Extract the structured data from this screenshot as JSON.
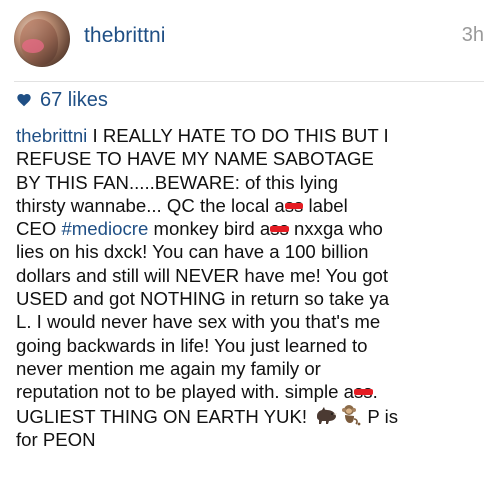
{
  "post": {
    "username": "thebrittni",
    "time_ago": "3h",
    "likes": "67 likes",
    "colors": {
      "link": "#1f4f85",
      "censor": "#e51c23",
      "time": "#9a9a9a"
    },
    "avatar_icon": "profile-photo",
    "heart_icon": "heart-icon",
    "emoji_icons": [
      "boar-emoji-icon",
      "monkey-emoji-icon"
    ],
    "caption": {
      "username": "thebrittni",
      "l1": " I REALLY HATE TO DO THIS BUT I",
      "l2": "REFUSE TO HAVE MY NAME SABOTAGE",
      "l3": "BY THIS FAN.....BEWARE: of this lying",
      "l4": "thirsty wannabe... QC the local a",
      "l4_censored": "ss",
      "l4_end": " label",
      "l5_start": "CEO ",
      "hashtag": "#mediocre",
      "l5_mid": " monkey bird a",
      "l5_censored": "ss",
      "l5_end": " nxxga who",
      "l6": "lies on his dxck! You can have a 100 billion",
      "l7": "dollars and still will NEVER have me! You got",
      "l8": "USED and got NOTHING in return so take ya",
      "l9": "L. I would never have sex with you that's me",
      "l10": "going backwards in life! You just learned to",
      "l11": "never mention me again my family or",
      "l12_start": "reputation not to be played with.  simple a",
      "l12_censored": "ss",
      "l12_end": ".",
      "l13_start": "UGLIEST THING ON EARTH YUK! ",
      "l13_end": " P is",
      "l14": "for PEON"
    }
  }
}
